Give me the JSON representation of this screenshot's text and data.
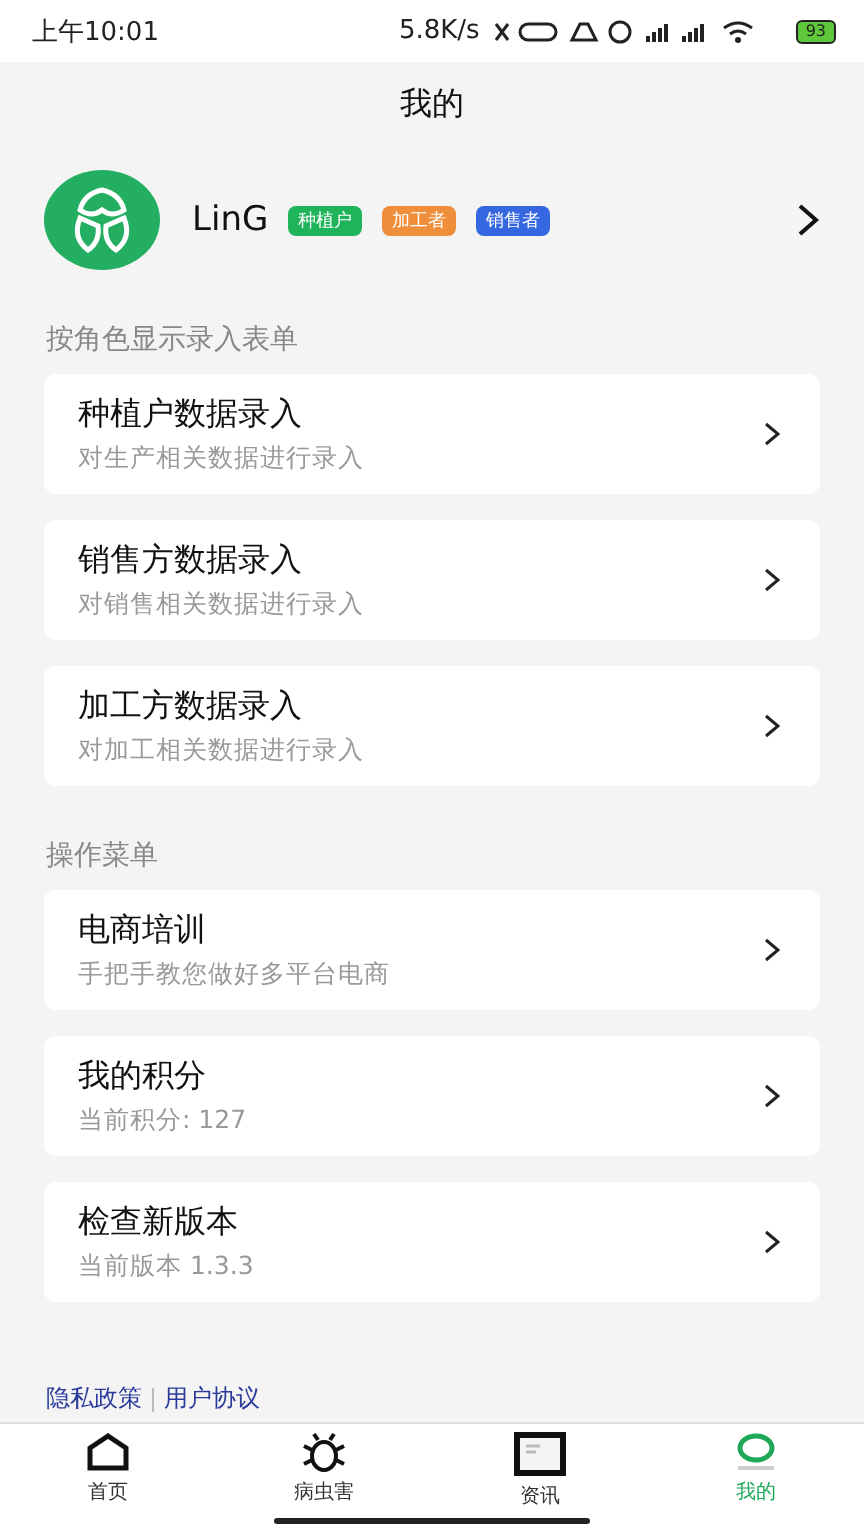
{
  "status_bar": {
    "time": "上午10:01",
    "speed": "5.8K/s",
    "battery": "93"
  },
  "title": "我的",
  "profile": {
    "name": "LinG",
    "tags": [
      {
        "label": "种植户",
        "color": "#1fb45a"
      },
      {
        "label": "加工者",
        "color": "#ef8f3c"
      },
      {
        "label": "销售者",
        "color": "#3467e0"
      }
    ]
  },
  "sections": [
    {
      "label": "按角色显示录入表单",
      "items": [
        {
          "title": "种植户数据录入",
          "subtitle": "对生产相关数据进行录入"
        },
        {
          "title": "销售方数据录入",
          "subtitle": "对销售相关数据进行录入"
        },
        {
          "title": "加工方数据录入",
          "subtitle": "对加工相关数据进行录入"
        }
      ]
    },
    {
      "label": "操作菜单",
      "items": [
        {
          "title": "电商培训",
          "subtitle": "手把手教您做好多平台电商"
        },
        {
          "title": "我的积分",
          "subtitle": "当前积分: 127"
        },
        {
          "title": "检查新版本",
          "subtitle": "当前版本 1.3.3"
        }
      ]
    }
  ],
  "links": [
    "隐私政策",
    "用户协议"
  ],
  "tabs": [
    {
      "label": "首页",
      "kind": "home",
      "selected": false
    },
    {
      "label": "病虫害",
      "kind": "bug",
      "selected": false
    },
    {
      "label": "资讯",
      "kind": "news",
      "selected": false
    },
    {
      "label": "我的",
      "kind": "me",
      "selected": true
    }
  ]
}
